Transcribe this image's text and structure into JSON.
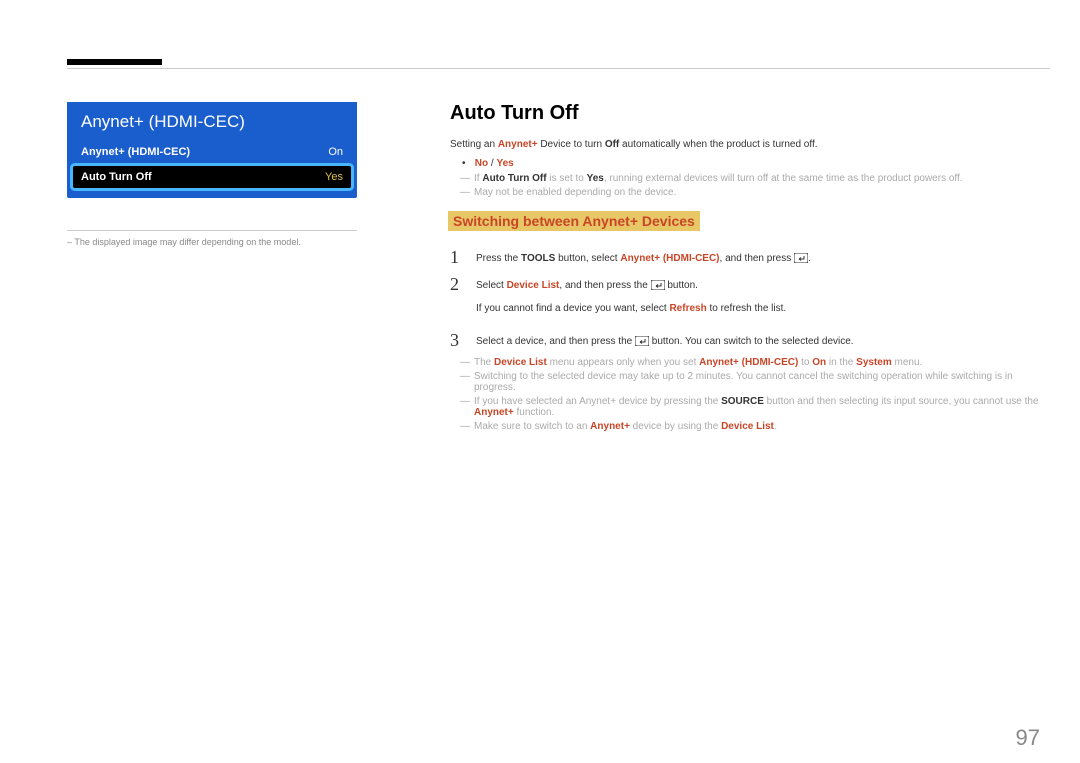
{
  "menu": {
    "title": "Anynet+ (HDMI-CEC)",
    "row1_label": "Anynet+ (HDMI-CEC)",
    "row1_value": "On",
    "row2_label": "Auto Turn Off",
    "row2_value": "Yes"
  },
  "left_note": "The displayed image may differ depending on the model.",
  "heading1": "Auto Turn Off",
  "intro_pre": "Setting an ",
  "intro_r1": "Anynet+",
  "intro_mid": " Device to turn ",
  "intro_off": "Off",
  "intro_post": " automatically when the product is turned off.",
  "no_yes_no": "No",
  "no_yes_sep": " / ",
  "no_yes_yes": "Yes",
  "note1_pre": "If ",
  "note1_ato": "Auto Turn Off",
  "note1_mid": " is set to ",
  "note1_yes": "Yes",
  "note1_post": ", running external devices will turn off at the same time as the product powers off.",
  "note2": "May not be enabled depending on the device.",
  "heading2": "Switching between Anynet+ Devices",
  "steps": {
    "s1_pre": "Press the ",
    "s1_tools": "TOOLS",
    "s1_mid": " button, select ",
    "s1_anynet": "Anynet+ (HDMI-CEC)",
    "s1_post": ", and then press ",
    "s1_dot": ".",
    "s2_pre": "Select ",
    "s2_dl": "Device List",
    "s2_mid": ", and then press the ",
    "s2_post": " button.",
    "s2_extra_pre": "If you cannot find a device you want, select ",
    "s2_refresh": "Refresh",
    "s2_extra_post": " to refresh the list.",
    "s3_pre": "Select a device, and then press the ",
    "s3_post": " button. You can switch to the selected device."
  },
  "bottom_notes": {
    "n1_pre": "The ",
    "n1_dl": "Device List",
    "n1_mid": " menu appears only when you set ",
    "n1_anynet": "Anynet+ (HDMI-CEC)",
    "n1_to": " to ",
    "n1_on": "On",
    "n1_in": " in the ",
    "n1_sys": "System",
    "n1_post": " menu.",
    "n2": "Switching to the selected device may take up to 2 minutes. You cannot cancel the switching operation while switching is in progress.",
    "n3_pre": "If you have selected an Anynet+ device by pressing the ",
    "n3_src": "SOURCE",
    "n3_mid": " button and then selecting its input source, you cannot use the ",
    "n3_anynet": "Anynet+",
    "n3_post": " function.",
    "n4_pre": "Make sure to switch to an ",
    "n4_anynet": "Anynet+",
    "n4_mid": " device by using the ",
    "n4_dl": "Device List",
    "n4_post": "."
  },
  "page_number": "97"
}
